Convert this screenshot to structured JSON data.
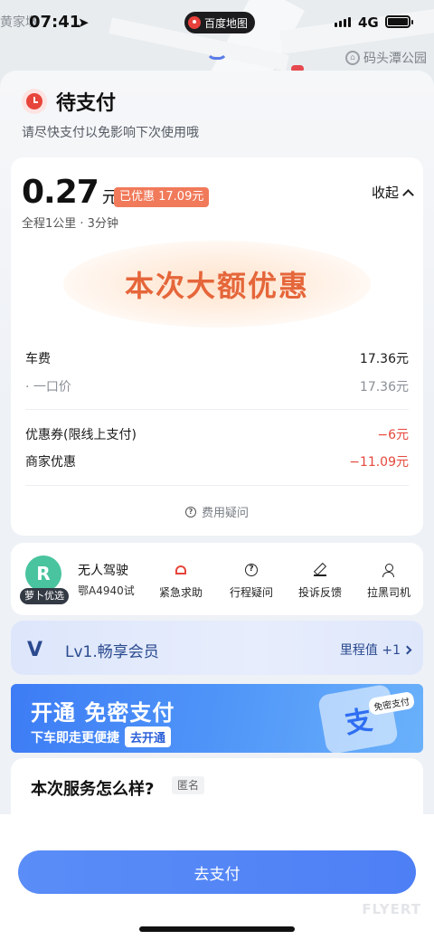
{
  "map": {
    "left_label": "黄家墩",
    "poi_label": "码头潭公园"
  },
  "status_bar": {
    "time": "07:41",
    "app_name": "百度地图",
    "network": "4G"
  },
  "header": {
    "title": "待支付",
    "subtitle": "请尽快支付以免影响下次使用哦"
  },
  "fare": {
    "amount": "0.27",
    "unit": "元",
    "discount_badge": "已优惠 17.09元",
    "collapse_label": "收起",
    "trip_info": "全程1公里 · 3分钟",
    "promo_text": "本次大额优惠",
    "rows": [
      {
        "label": "车费",
        "value": "17.36元"
      },
      {
        "label": "· 一口价",
        "value": "17.36元"
      },
      {
        "label": "优惠券(限线上支付)",
        "value": "−6元"
      },
      {
        "label": "商家优惠",
        "value": "−11.09元"
      }
    ],
    "fee_question": "费用疑问"
  },
  "driver": {
    "brand_tag": "萝卜优选",
    "name": "无人驾驶",
    "plate": "鄂A4940试",
    "actions": [
      {
        "label": "紧急求助",
        "icon": "alarm-icon"
      },
      {
        "label": "行程疑问",
        "icon": "question-icon"
      },
      {
        "label": "投诉反馈",
        "icon": "pen-icon"
      },
      {
        "label": "拉黑司机",
        "icon": "block-user-icon"
      }
    ]
  },
  "member": {
    "title": "Lv1.畅享会员",
    "points": "里程值 +1"
  },
  "pay_banner": {
    "title": "开通 免密支付",
    "subtitle": "下车即走更便捷",
    "cta": "去开通",
    "tag": "免密支付",
    "illus_char": "支"
  },
  "rating": {
    "title": "本次服务怎么样?",
    "anon": "匿名"
  },
  "pay_button": "去支付",
  "colors": {
    "accent": "#4e7ff5",
    "danger": "#e5483c",
    "promo": "#e5663a",
    "brand_green": "#49c49e"
  }
}
